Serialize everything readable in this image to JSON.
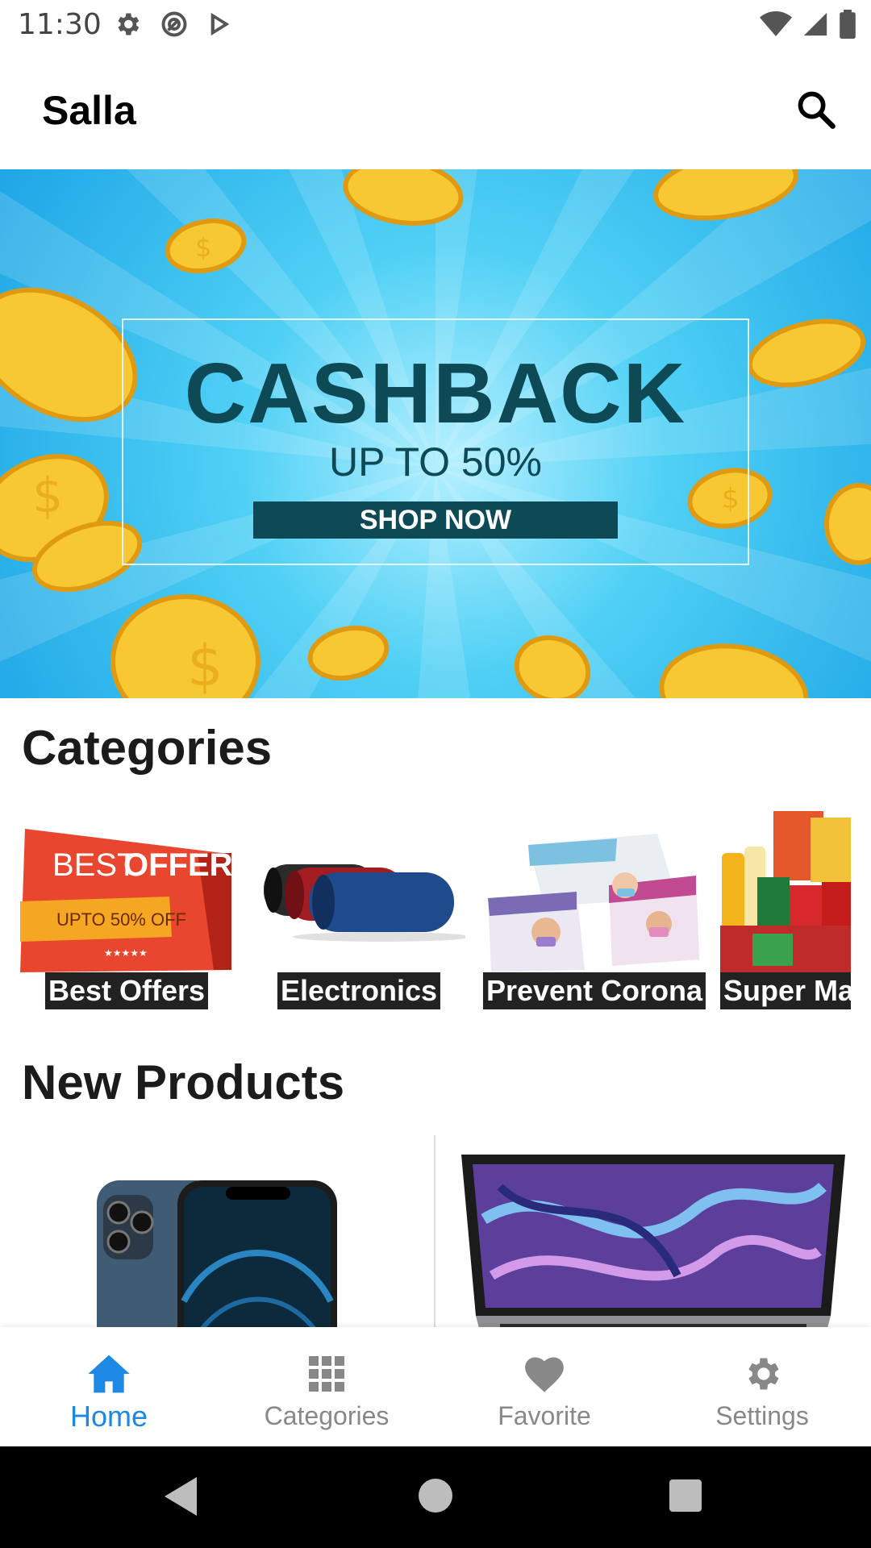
{
  "status_bar": {
    "time": "11:30"
  },
  "app_bar": {
    "title": "Salla"
  },
  "banner": {
    "headline": "CASHBACK",
    "subline": "UP TO 50%",
    "cta": "SHOP NOW",
    "colors": {
      "sky": "#1ea6e6",
      "text": "#0e4a55",
      "coin": "#f7c832"
    }
  },
  "categories": {
    "title": "Categories",
    "items": [
      {
        "label": "Best Offers",
        "art": {
          "line1": "BEST",
          "line2": "OFFER",
          "tag": "UPTO 50% OFF",
          "stars": "★★★★★"
        }
      },
      {
        "label": "Electronics"
      },
      {
        "label": "Prevent Corona"
      },
      {
        "label": "Super Market"
      }
    ]
  },
  "new_products": {
    "title": "New Products",
    "items": [
      {
        "icon": "smartphone-product-image"
      },
      {
        "icon": "laptop-product-image"
      }
    ]
  },
  "bottom_nav": {
    "active": "home",
    "accent": "#1e88e5",
    "inactive": "#888888",
    "items": [
      {
        "id": "home",
        "label": "Home",
        "icon": "home-icon"
      },
      {
        "id": "categories",
        "label": "Categories",
        "icon": "grid-icon"
      },
      {
        "id": "favorite",
        "label": "Favorite",
        "icon": "heart-icon"
      },
      {
        "id": "settings",
        "label": "Settings",
        "icon": "gear-icon"
      }
    ]
  }
}
